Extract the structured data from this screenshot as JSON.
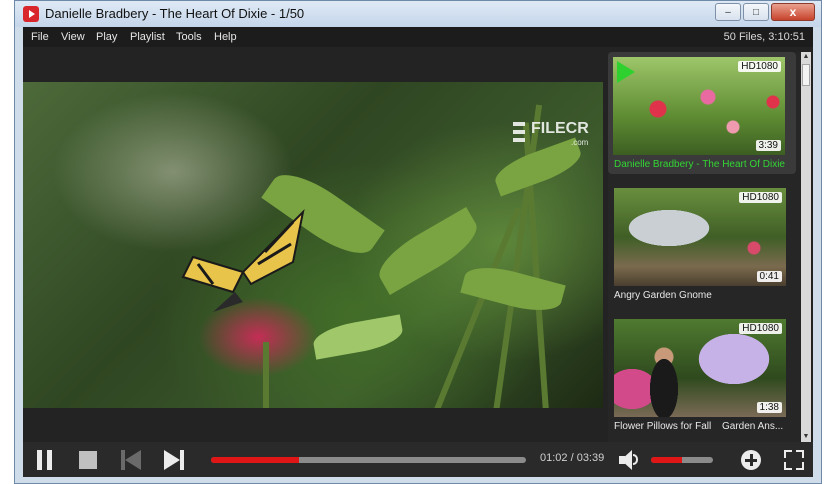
{
  "window": {
    "title": "Danielle Bradbery - The Heart Of Dixie - 1/50",
    "minimize_label": "–",
    "maximize_label": "□",
    "close_label": "x"
  },
  "menu": {
    "items": [
      "File",
      "View",
      "Play",
      "Playlist",
      "Tools",
      "Help"
    ],
    "file_count": "50 Files, 3:10:51"
  },
  "watermark": {
    "text": "FILECR",
    "suffix": ".com"
  },
  "playlist": [
    {
      "title": "Danielle Bradbery - The Heart Of Dixie",
      "quality": "HD1080",
      "duration": "3:39",
      "playing": true
    },
    {
      "title": "Angry Garden Gnome",
      "quality": "HD1080",
      "duration": "0:41",
      "playing": false
    },
    {
      "title": "Flower Pillows for Fall",
      "quality": "HD1080",
      "duration": "1:38",
      "playing": false,
      "next_title": "Garden Ans..."
    }
  ],
  "player": {
    "time": "01:02 / 03:39",
    "progress": 0.28,
    "volume": 0.5
  },
  "colors": {
    "accent": "#e01515",
    "active_title": "#33d633",
    "play_flag": "#2fd12f"
  },
  "icons": {
    "pause": "pause-icon",
    "stop": "stop-icon",
    "previous": "previous-icon",
    "next": "next-icon",
    "volume": "volume-icon",
    "add": "add-icon",
    "fullscreen": "fullscreen-icon"
  }
}
